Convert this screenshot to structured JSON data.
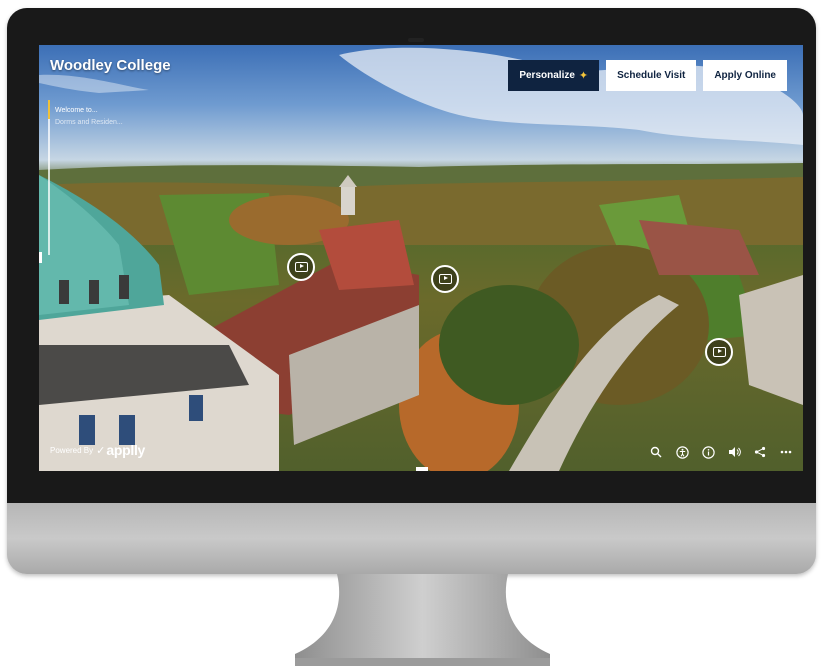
{
  "header": {
    "site_title": "Woodley College",
    "personalize_label": "Personalize",
    "schedule_label": "Schedule Visit",
    "apply_label": "Apply Online"
  },
  "tour": {
    "progress_percent": 12,
    "breadcrumb_current": "Welcome to...",
    "breadcrumb_next": "Dorms and Residen..."
  },
  "footer": {
    "powered_label": "Powered By",
    "brand": "applly"
  },
  "icons": {
    "hotspot": "play-video-icon",
    "controls": [
      "search-icon",
      "accessibility-icon",
      "info-icon",
      "volume-icon",
      "share-icon",
      "more-icon"
    ]
  },
  "colors": {
    "accent_dark": "#0f2340",
    "progress": "#f0c23a",
    "bezel": "#191919"
  }
}
